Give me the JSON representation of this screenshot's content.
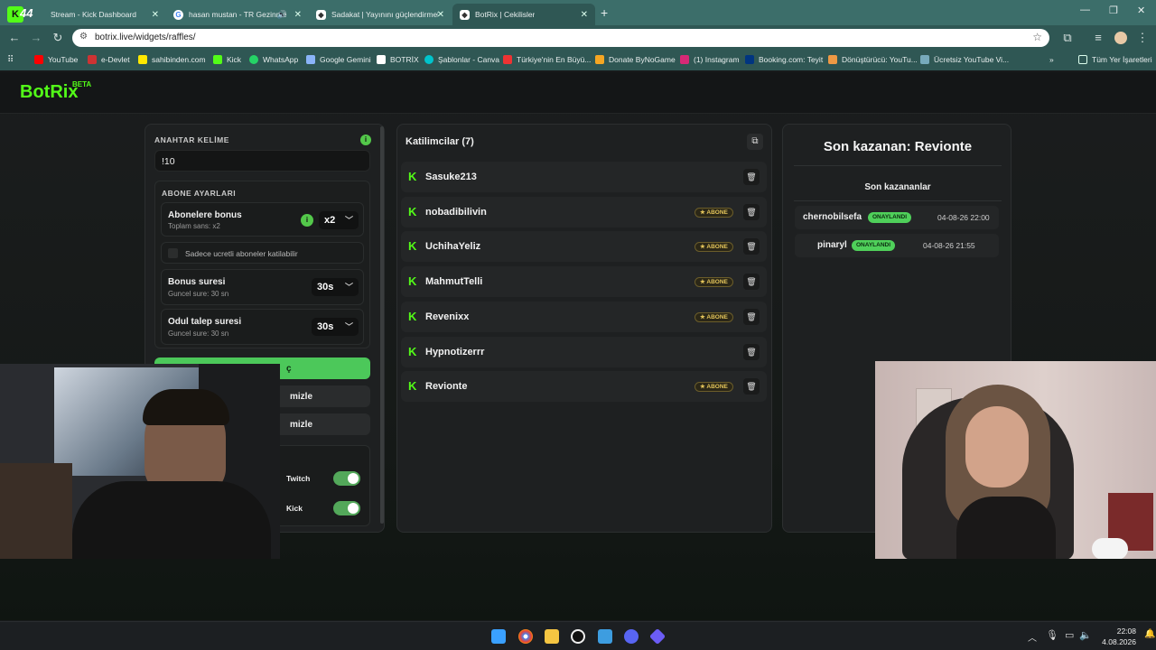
{
  "browser": {
    "tabs": [
      {
        "title": "Stream - Kick Dashboard",
        "badge": "44"
      },
      {
        "title": "hasan mustan - TR Gezinme"
      },
      {
        "title": "Sadakat | Yayınını güçlendirmek"
      },
      {
        "title": "BotRix | Cekilisler",
        "active": true
      }
    ],
    "url": "botrix.live/widgets/raffles/",
    "bookmarks": [
      "YouTube",
      "e-Devlet",
      "sahibinden.com",
      "Kick",
      "WhatsApp",
      "Google Gemini",
      "BOTRİX",
      "Şablonlar - Canva",
      "Türkiye'nin En Büyü...",
      "Donate ByNoGame",
      "(1) Instagram",
      "Booking.com: Teyit",
      "Dönüştürücü: YouTu...",
      "Ücretsiz YouTube Vi..."
    ],
    "all_bookmarks": "Tüm Yer İşaretleri"
  },
  "app": {
    "logo": "BotRix",
    "beta": "BETA"
  },
  "settings": {
    "keyword_label": "ANAHTAR KELİME",
    "keyword_value": "!10",
    "subscriber_section": "ABONE AYARLARI",
    "bonus_title": "Abonelere bonus",
    "bonus_desc": "Toplam sans: x2",
    "bonus_value": "x2",
    "only_paid_label": "Sadece ucretli aboneler katilabilir",
    "bonus_time_title": "Bonus suresi",
    "bonus_time_desc": "Guncel sure: 30 sn",
    "bonus_time_value": "30s",
    "claim_time_title": "Odul talep suresi",
    "claim_time_desc": "Guncel sure: 30 sn",
    "claim_time_value": "30s",
    "primary_button": "ç",
    "button2": "mizle",
    "button3": "mizle",
    "platform_twitch": "Twitch",
    "platform_kick": "Kick"
  },
  "participants": {
    "header": "Katilimcilar (7)",
    "sub_badge": "★ ABONE",
    "list": [
      {
        "name": "Sasuke213",
        "subscriber": false
      },
      {
        "name": "nobadibilivin",
        "subscriber": true
      },
      {
        "name": "UchihaYeliz",
        "subscriber": true
      },
      {
        "name": "MahmutTelli",
        "subscriber": true
      },
      {
        "name": "Revenixx",
        "subscriber": true
      },
      {
        "name": "Hypnotizerrr",
        "subscriber": false
      },
      {
        "name": "Revionte",
        "subscriber": true
      }
    ]
  },
  "winners": {
    "last_winner": "Son kazanan: Revionte",
    "recent_header": "Son kazananlar",
    "approved_badge": "ONAYLANDI",
    "list": [
      {
        "name": "chernobilsefa",
        "date": "04-08-26 22:00"
      },
      {
        "name": "pinaryl",
        "date": "04-08-26 21:55"
      }
    ]
  },
  "taskbar": {
    "time": "22:08",
    "date": "4.08.2026"
  }
}
